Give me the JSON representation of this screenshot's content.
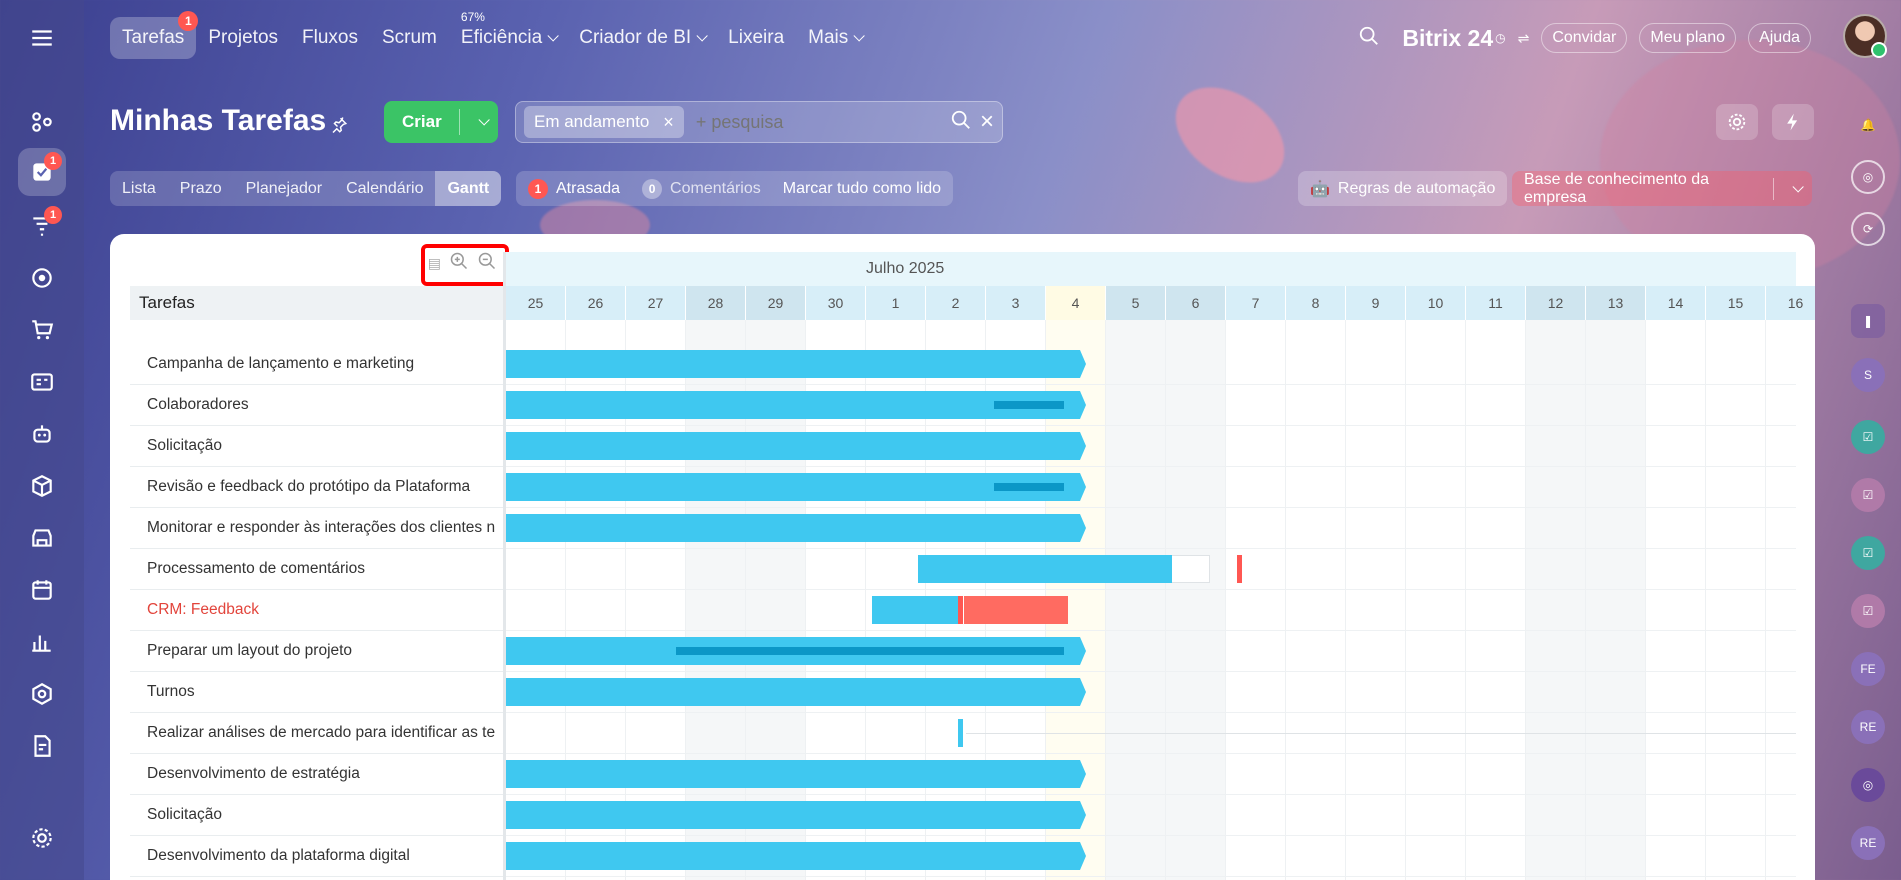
{
  "topnav": {
    "items": [
      {
        "label": "Tarefas",
        "badge": "1",
        "active": true
      },
      {
        "label": "Projetos"
      },
      {
        "label": "Fluxos"
      },
      {
        "label": "Scrum"
      },
      {
        "label": "Eficiência",
        "pct": "67%",
        "dropdown": true
      },
      {
        "label": "Criador de BI",
        "dropdown": true
      },
      {
        "label": "Lixeira"
      },
      {
        "label": "Mais",
        "dropdown": true
      }
    ],
    "brand": "Bitrix 24",
    "invite": "Convidar",
    "plan": "Meu plano",
    "help": "Ajuda"
  },
  "left_rail": {
    "badges": [
      "1",
      "1"
    ]
  },
  "header": {
    "title": "Minhas Tarefas",
    "create_label": "Criar",
    "filter_chip": "Em andamento",
    "search_placeholder": "+ pesquisa"
  },
  "view_tabs": [
    "Lista",
    "Prazo",
    "Planejador",
    "Calendário",
    "Gantt"
  ],
  "active_view": "Gantt",
  "counters": {
    "overdue_count": "1",
    "overdue_label": "Atrasada",
    "comments_count": "0",
    "comments_label": "Comentários",
    "mark_read": "Marcar tudo como lido"
  },
  "automation_label": "Regras de automação",
  "kb_label": "Base de conhecimento da empresa",
  "gantt": {
    "column_header": "Tarefas",
    "month": "Julho 2025",
    "days": [
      "25",
      "26",
      "27",
      "28",
      "29",
      "30",
      "1",
      "2",
      "3",
      "4",
      "5",
      "6",
      "7",
      "8",
      "9",
      "10",
      "11",
      "12",
      "13",
      "14",
      "15",
      "16"
    ],
    "weekend_days": [
      "28",
      "29",
      "5",
      "6",
      "12",
      "13"
    ],
    "today": "4",
    "tasks": [
      "Campanha de lançamento e marketing",
      "Colaboradores",
      "Solicitação",
      "Revisão e feedback do protótipo da Plataforma",
      "Monitorar e responder às interações dos clientes n",
      "Processamento de comentários",
      "CRM: Feedback",
      "Preparar um layout do projeto",
      "Turnos",
      "Realizar análises de mercado para identificar as te",
      "Desenvolvimento de estratégia",
      "Solicitação",
      "Desenvolvimento da plataforma digital"
    ],
    "overdue_task": "CRM: Feedback"
  },
  "right_rail": {
    "initials": [
      "S",
      "FE",
      "RE",
      "RE"
    ]
  },
  "colors": {
    "accent": "#3bc466",
    "bar": "#3fc8f0",
    "progress": "#0b97c7",
    "overdue": "#ff6b61",
    "highlight": "#ff0000"
  }
}
